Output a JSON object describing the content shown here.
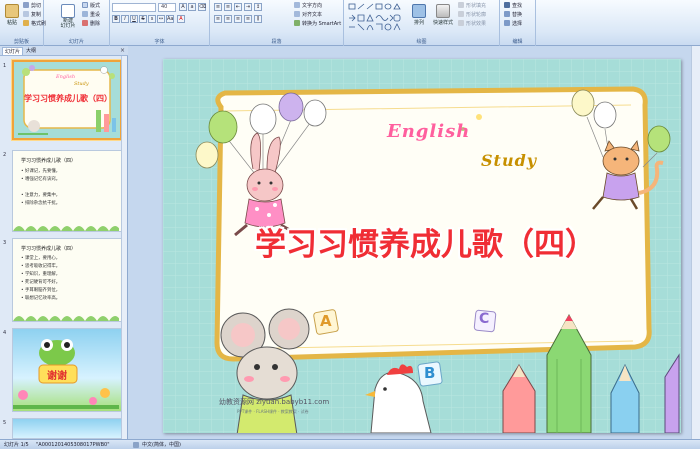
{
  "ribbon": {
    "clipboard": {
      "label": "剪贴板",
      "paste": "粘贴",
      "cut": "剪切",
      "copy": "复制",
      "format_painter": "格式刷"
    },
    "slides": {
      "label": "幻灯片",
      "new_slide": "新建\n幻灯片",
      "layout": "版式",
      "reset": "重设",
      "delete": "删除"
    },
    "font": {
      "label": "字体",
      "font_name": "",
      "font_size": "40"
    },
    "paragraph": {
      "label": "段落",
      "text_direction": "文字方向",
      "align_text": "对齐文本",
      "convert_smartart": "转换为 SmartArt"
    },
    "drawing": {
      "label": "绘图",
      "arrange": "排列",
      "quick_styles": "快速样式",
      "shape_fill": "形状填充",
      "shape_outline": "形状轮廓",
      "shape_effects": "形状效果"
    },
    "editing": {
      "label": "编辑",
      "find": "查找",
      "replace": "替换",
      "select": "选择"
    }
  },
  "left_panel": {
    "tabs": [
      "幻灯片",
      "大纲"
    ],
    "close": "×",
    "slides": [
      {
        "num": "1",
        "title": "学习习惯养成儿歌（四）",
        "english_1": "English",
        "english_2": "Study"
      },
      {
        "num": "2",
        "title": "学习习惯养成儿歌（四）",
        "lines": [
          "• 好课记，先要懂，",
          "• 嗜强记忆有诀窍。",
          "",
          "• 注意力，要集中，",
          "• 排除杂念抗干扰。"
        ]
      },
      {
        "num": "3",
        "title": "学习习惯养成儿歌（四）",
        "lines": [
          "• 课堂上，要用心，",
          "• 思考吸收记得牢。",
          "• 学知识，重理解，",
          "• 死记硬背可不好。",
          "• 手耳眼脑齐到位，",
          "• 联想记忆效率高。"
        ]
      },
      {
        "num": "4",
        "title": "谢谢"
      },
      {
        "num": "5"
      }
    ]
  },
  "slide": {
    "title": "学习习惯养成儿歌（四）",
    "english_1": "English",
    "english_2": "Study",
    "watermark": "幼教资源网 ziyuan.babyb11.com",
    "watermark_sub": "PPT课件 · FLASH课件 · 教案教案 · 试卷",
    "blocks": [
      "A",
      "B",
      "C"
    ]
  },
  "statusbar": {
    "slide_count": "幻灯片 1/5",
    "theme": "\"A0001201405308017PWB0\"",
    "language": "中文(简体，中国)"
  },
  "colors": {
    "title_red": "#f02d35",
    "slide_bg": "#a6ddd8",
    "active_thumb_border": "#f0a33b"
  }
}
